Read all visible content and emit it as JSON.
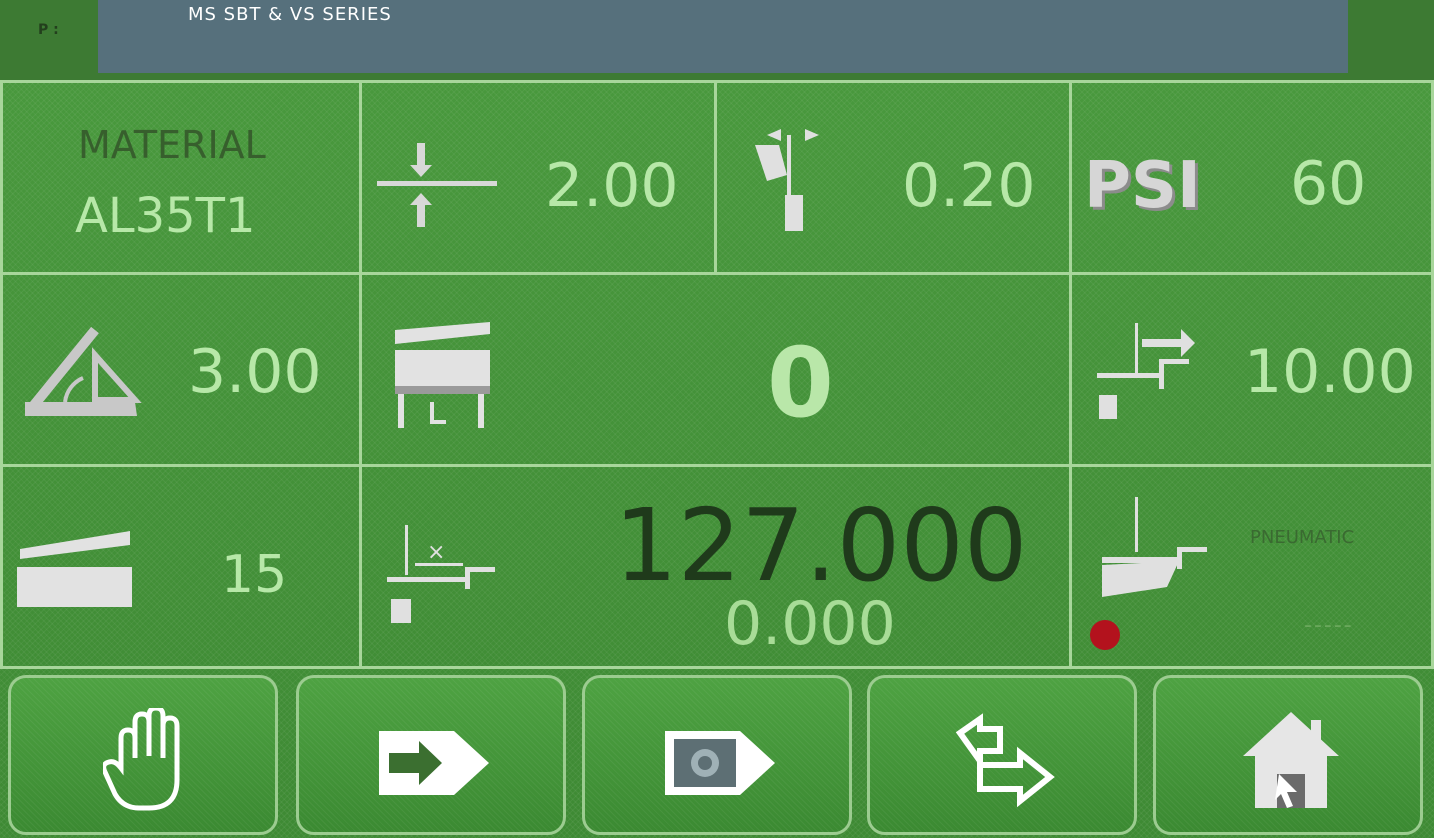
{
  "header": {
    "title": "MS SBT & VS SERIES",
    "top_mark": "P :"
  },
  "row1": {
    "material": {
      "label": "MATERIAL",
      "value": "AL35T1"
    },
    "thickness": {
      "value": "2.00",
      "icon": "sheet-thickness-icon"
    },
    "clearance": {
      "value": "0.20",
      "icon": "blade-clearance-icon"
    },
    "pressure": {
      "unit": "PSI",
      "value": "60"
    }
  },
  "row2": {
    "angle": {
      "value": "3.00",
      "icon": "rake-angle-icon"
    },
    "counter": {
      "value": "0",
      "icon": "shear-counter-icon"
    },
    "retract": {
      "value": "10.00",
      "icon": "backgauge-retract-icon"
    }
  },
  "row3": {
    "stroke": {
      "value": "15",
      "icon": "stroke-length-icon"
    },
    "position": {
      "target": "127.000",
      "actual": "0.000",
      "icon": "backgauge-position-icon"
    },
    "mode": {
      "label": "PNEUMATIC",
      "status": "-----",
      "icon": "pneumatic-support-icon",
      "indicator_color": "#b3121d"
    }
  },
  "buttons": [
    {
      "name": "stop",
      "icon": "hand-stop-icon"
    },
    {
      "name": "next",
      "icon": "arrow-right-icon"
    },
    {
      "name": "program",
      "icon": "program-icon"
    },
    {
      "name": "auto",
      "icon": "return-arrows-icon"
    },
    {
      "name": "home",
      "icon": "home-icon"
    }
  ]
}
